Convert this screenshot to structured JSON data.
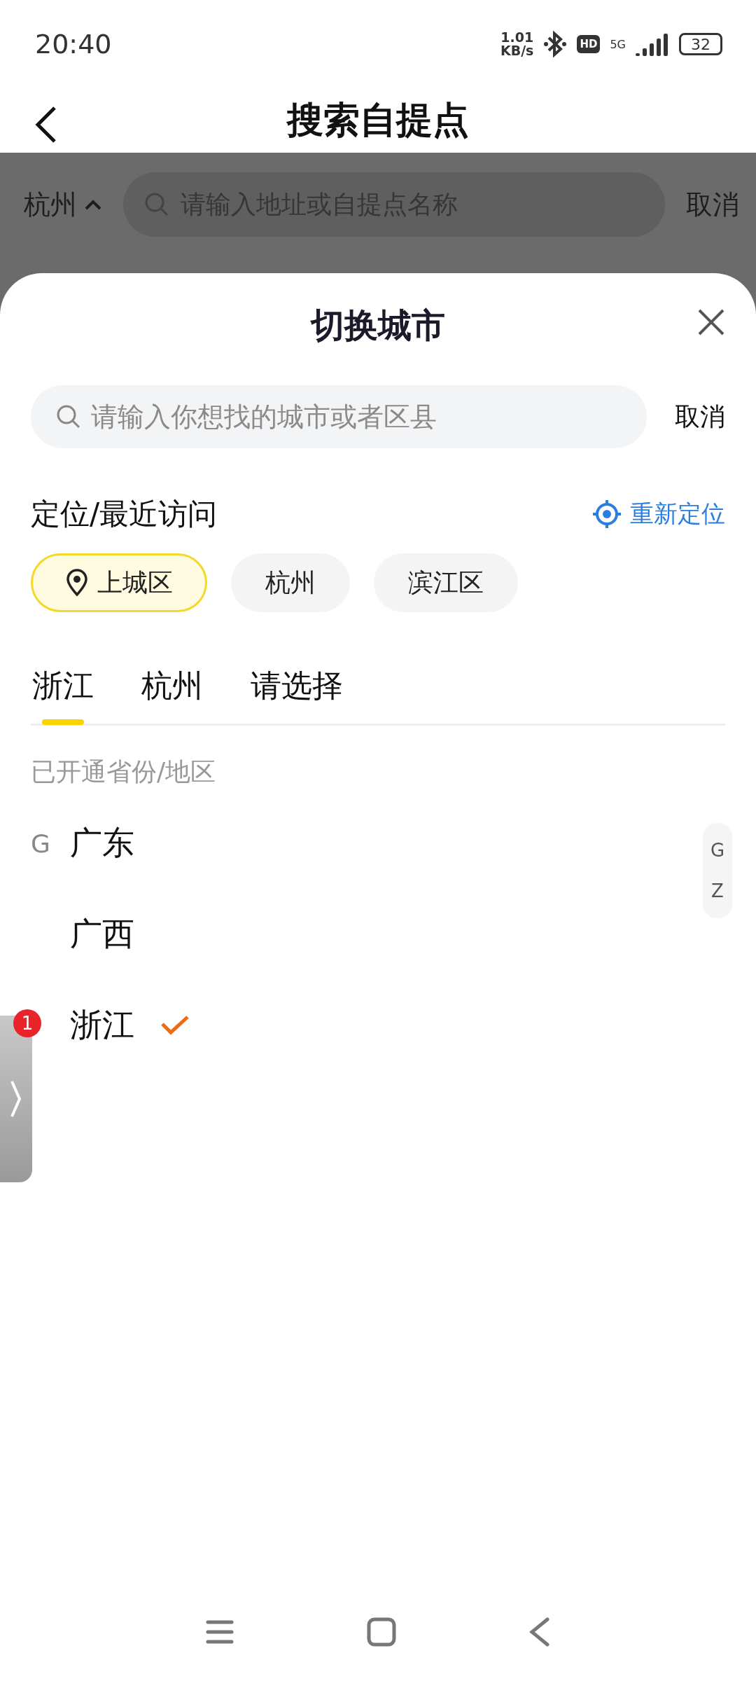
{
  "status_bar": {
    "time": "20:40",
    "net_speed": "1.01",
    "net_unit": "KB/s",
    "hd": "HD",
    "network": "5G",
    "battery": "32"
  },
  "header": {
    "title": "搜索自提点"
  },
  "search_bar": {
    "city": "杭州",
    "placeholder": "请输入地址或自提点名称",
    "cancel": "取消"
  },
  "sheet": {
    "title": "切换城市",
    "search": {
      "placeholder": "请输入你想找的城市或者区县",
      "cancel": "取消"
    },
    "recent": {
      "heading": "定位/最近访问",
      "relocate": "重新定位",
      "chips": [
        {
          "label": "上城区",
          "kind": "location",
          "selected": true
        },
        {
          "label": "杭州",
          "kind": "plain",
          "selected": false
        },
        {
          "label": "滨江区",
          "kind": "plain",
          "selected": false
        }
      ]
    },
    "tabs": [
      {
        "label": "浙江",
        "selected": true
      },
      {
        "label": "杭州",
        "selected": false
      },
      {
        "label": "请选择",
        "selected": false
      }
    ],
    "list_heading": "已开通省份/地区",
    "provinces": [
      {
        "letter": "G",
        "name": "广东",
        "selected": false
      },
      {
        "name": "广西",
        "selected": false
      },
      {
        "name": "浙江",
        "selected": true
      }
    ],
    "index": [
      "G",
      "Z"
    ]
  },
  "floating_tab": {
    "badge": "1"
  }
}
